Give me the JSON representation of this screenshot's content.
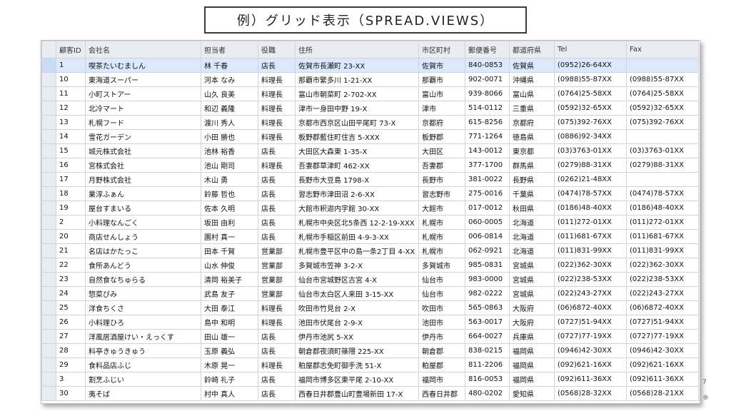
{
  "title": "例）グリッド表示（SPREAD.VIEWS）",
  "grid": {
    "columns": [
      "顧客ID",
      "会社名",
      "担当者",
      "役職",
      "住所",
      "市区町村",
      "郵便番号",
      "都道府県",
      "Tel",
      "Fax"
    ],
    "selected_row": 0,
    "rows": [
      [
        "1",
        "喫茶たいむましん",
        "林 千春",
        "店長",
        "佐賀市長瀬町 23-XX",
        "佐賀市",
        "840-0853",
        "佐賀県",
        "(0952)26-64XX",
        ""
      ],
      [
        "10",
        "東海道スーパー",
        "河本 なみ",
        "料理長",
        "那覇市繁多川 1-21-XX",
        "那覇市",
        "902-0071",
        "沖縄県",
        "(0988)55-87XX",
        "(0988)55-87XX"
      ],
      [
        "11",
        "小町ストアー",
        "山久 良美",
        "料理長",
        "富山市朝菜町 2-702-XX",
        "富山市",
        "939-8066",
        "富山県",
        "(0764)25-58XX",
        "(0764)25-58XX"
      ],
      [
        "12",
        "北冷マート",
        "和辺 義隆",
        "料理長",
        "津市一身田中野 19-X",
        "津市",
        "514-0112",
        "三重県",
        "(0592)32-65XX",
        "(0592)32-65XX"
      ],
      [
        "13",
        "札幌フード",
        "渡川 秀人",
        "料理長",
        "京都市西京区山田平尾町 73-X",
        "京都府",
        "615-8256",
        "京都府",
        "(075)392-76XX",
        "(075)392-76XX"
      ],
      [
        "14",
        "雪花ガーデン",
        "小田 勝也",
        "料理長",
        "板野郡藍住町住吉 5-XXX",
        "板野郡",
        "771-1264",
        "徳島県",
        "(0886)92-34XX",
        ""
      ],
      [
        "15",
        "城元株式会社",
        "池林 裕香",
        "店長",
        "大田区大森東 1-35-X",
        "大田区",
        "143-0012",
        "東京都",
        "(03)3763-01XX",
        "(03)3763-01XX"
      ],
      [
        "16",
        "宮株式会社",
        "池山 剛司",
        "料理長",
        "吾妻郡草津町 462-XX",
        "吾妻郡",
        "377-1700",
        "群馬県",
        "(0279)88-31XX",
        "(0279)88-31XX"
      ],
      [
        "17",
        "月野株式会社",
        "木山 勇",
        "店長",
        "長野市大豆島 1798-X",
        "長野市",
        "381-0022",
        "長野県",
        "(0262)21-48XX",
        ""
      ],
      [
        "18",
        "業淳ふぁん",
        "鈴藤 哲也",
        "店長",
        "習志野市津田沼 2-6-XX",
        "習志野市",
        "275-0016",
        "千葉県",
        "(0474)78-57XX",
        "(0474)78-57XX"
      ],
      [
        "19",
        "屋台すまいる",
        "佐本 久明",
        "店長",
        "大館市釈迦内字館 30-XX",
        "大館市",
        "017-0012",
        "秋田県",
        "(0186)48-40XX",
        "(0186)48-40XX"
      ],
      [
        "2",
        "小料理なんごく",
        "坂田 由利",
        "店長",
        "札幌市中央区北5条西 12-2-19-XXX",
        "札幌市",
        "060-0005",
        "北海道",
        "(011)272-01XX",
        "(011)272-01XX"
      ],
      [
        "20",
        "商店せんしょう",
        "園村 真一",
        "店長",
        "札幌市手稲区前田 4-9-3-XX",
        "札幌市",
        "006-0814",
        "北海道",
        "(011)681-67XX",
        "(011)681-67XX"
      ],
      [
        "21",
        "名店はかたっこ",
        "田本 千賀",
        "営業部",
        "札幌市豊平区中の島一条2丁目 4-XX",
        "札幌市",
        "062-0921",
        "北海道",
        "(011)831-99XX",
        "(011)831-99XX"
      ],
      [
        "22",
        "食所あんどう",
        "山水 伸俊",
        "営業部",
        "多賀城市笠神 3-2-X",
        "多賀城市",
        "985-0831",
        "宮城県",
        "(022)362-30XX",
        "(022)362-30XX"
      ],
      [
        "23",
        "自然食なちゅらる",
        "清岡 裕美子",
        "営業部",
        "仙台市宮城野区古宮 4-X",
        "仙台市",
        "983-0000",
        "宮城県",
        "(022)238-53XX",
        "(022)238-53XX"
      ],
      [
        "24",
        "惣菜ぴみ",
        "武島 友子",
        "営業部",
        "仙台市太白区人来田 3-15-XX",
        "仙台市",
        "982-0222",
        "宮城県",
        "(022)243-27XX",
        "(022)243-27XX"
      ],
      [
        "25",
        "洋食ちくさ",
        "大田 泰江",
        "料理長",
        "吹田市竹見台 2-X",
        "吹田市",
        "565-0863",
        "大阪府",
        "(06)6872-40XX",
        "(06)6872-40XX"
      ],
      [
        "26",
        "小料理ひろ",
        "島中 和明",
        "料理長",
        "池田市伏尾台 2-9-X",
        "池田市",
        "563-0017",
        "大阪府",
        "(0727)51-94XX",
        "(0727)51-94XX"
      ],
      [
        "27",
        "洋風居酒屋けい・えっくす",
        "田山 雄一",
        "店長",
        "伊丹市池尻 5-XX",
        "伊丹市",
        "664-0027",
        "兵庫県",
        "(0727)77-19XX",
        "(0727)77-19XX"
      ],
      [
        "28",
        "料亭きゅうきゅう",
        "玉原 義弘",
        "店長",
        "朝倉郡夜須町篠隈 225-XX",
        "朝倉郡",
        "838-0215",
        "福岡県",
        "(0946)42-30XX",
        "(0946)42-30XX"
      ],
      [
        "29",
        "食料品店ふじ",
        "木原 晃一",
        "料理長",
        "粕屋郡志免町御手洗 51-X",
        "粕屋郡",
        "811-2206",
        "福岡県",
        "(092)621-16XX",
        "(092)621-16XX"
      ],
      [
        "3",
        "割烹ふじい",
        "鈴崎 礼子",
        "店長",
        "福岡市博多区東平尾 2-10-XX",
        "福岡市",
        "816-0053",
        "福岡県",
        "(092)611-36XX",
        "(092)611-36XX"
      ],
      [
        "30",
        "夷そば",
        "村中 真人",
        "店長",
        "西春日井郡豊山町豊場新田 17-X",
        "西春日井郡",
        "480-0202",
        "愛知県",
        "(0568)28-32XX",
        "(0568)28-21XX"
      ]
    ]
  },
  "side_marks": [
    "7",
    "®"
  ],
  "colors": {
    "header_bg": "#e9edf2",
    "selected_row_bg": "#dce9fb",
    "grid_line": "#cfd4da"
  }
}
